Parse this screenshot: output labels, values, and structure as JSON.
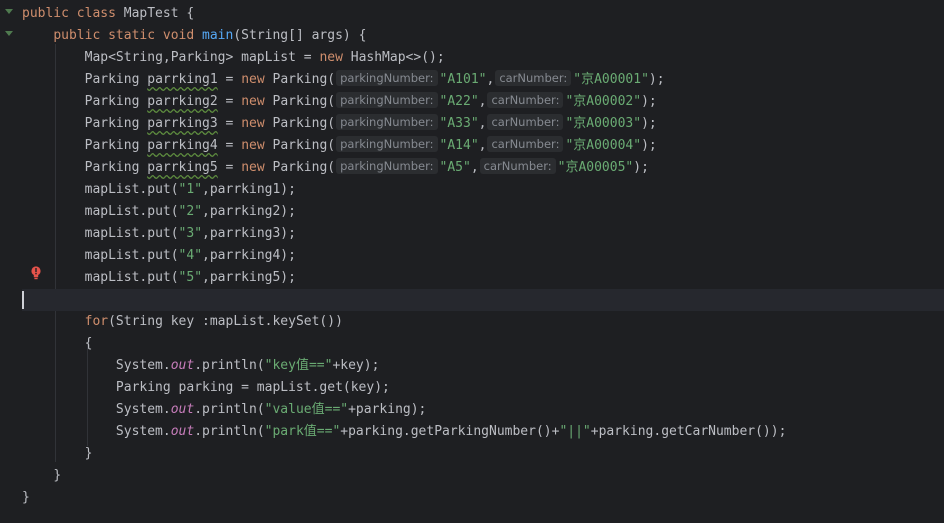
{
  "editor": {
    "lines": [
      {
        "indent": "",
        "tokens": [
          {
            "t": "public class ",
            "c": "kw"
          },
          {
            "t": "MapTest {",
            "c": "plain"
          }
        ]
      },
      {
        "indent": "    ",
        "tokens": [
          {
            "t": "public static void ",
            "c": "kw"
          },
          {
            "t": "main",
            "c": "fn"
          },
          {
            "t": "(String[] args) {",
            "c": "plain"
          }
        ]
      },
      {
        "indent": "        ",
        "tokens": [
          {
            "t": "Map<String,Parking> mapList = ",
            "c": "plain"
          },
          {
            "t": "new ",
            "c": "kw"
          },
          {
            "t": "HashMap<>();",
            "c": "plain"
          }
        ]
      },
      {
        "indent": "        ",
        "tokens": [
          {
            "t": "Parking ",
            "c": "plain"
          },
          {
            "t": "parrking1",
            "c": "plain warn"
          },
          {
            "t": " = ",
            "c": "plain"
          },
          {
            "t": "new ",
            "c": "kw"
          },
          {
            "t": "Parking(",
            "c": "plain"
          },
          {
            "t": "parkingNumber:",
            "c": "hint"
          },
          {
            "t": "\"A101\"",
            "c": "str"
          },
          {
            "t": ",",
            "c": "plain"
          },
          {
            "t": "carNumber:",
            "c": "hint"
          },
          {
            "t": "\"京A00001\"",
            "c": "str"
          },
          {
            "t": ");",
            "c": "plain"
          }
        ]
      },
      {
        "indent": "        ",
        "tokens": [
          {
            "t": "Parking ",
            "c": "plain"
          },
          {
            "t": "parrking2",
            "c": "plain warn"
          },
          {
            "t": " = ",
            "c": "plain"
          },
          {
            "t": "new ",
            "c": "kw"
          },
          {
            "t": "Parking(",
            "c": "plain"
          },
          {
            "t": "parkingNumber:",
            "c": "hint"
          },
          {
            "t": "\"A22\"",
            "c": "str"
          },
          {
            "t": ",",
            "c": "plain"
          },
          {
            "t": "carNumber:",
            "c": "hint"
          },
          {
            "t": "\"京A00002\"",
            "c": "str"
          },
          {
            "t": ");",
            "c": "plain"
          }
        ]
      },
      {
        "indent": "        ",
        "tokens": [
          {
            "t": "Parking ",
            "c": "plain"
          },
          {
            "t": "parrking3",
            "c": "plain warn"
          },
          {
            "t": " = ",
            "c": "plain"
          },
          {
            "t": "new ",
            "c": "kw"
          },
          {
            "t": "Parking(",
            "c": "plain"
          },
          {
            "t": "parkingNumber:",
            "c": "hint"
          },
          {
            "t": "\"A33\"",
            "c": "str"
          },
          {
            "t": ",",
            "c": "plain"
          },
          {
            "t": "carNumber:",
            "c": "hint"
          },
          {
            "t": "\"京A00003\"",
            "c": "str"
          },
          {
            "t": ");",
            "c": "plain"
          }
        ]
      },
      {
        "indent": "        ",
        "tokens": [
          {
            "t": "Parking ",
            "c": "plain"
          },
          {
            "t": "parrking4",
            "c": "plain warn"
          },
          {
            "t": " = ",
            "c": "plain"
          },
          {
            "t": "new ",
            "c": "kw"
          },
          {
            "t": "Parking(",
            "c": "plain"
          },
          {
            "t": "parkingNumber:",
            "c": "hint"
          },
          {
            "t": "\"A14\"",
            "c": "str"
          },
          {
            "t": ",",
            "c": "plain"
          },
          {
            "t": "carNumber:",
            "c": "hint"
          },
          {
            "t": "\"京A00004\"",
            "c": "str"
          },
          {
            "t": ");",
            "c": "plain"
          }
        ]
      },
      {
        "indent": "        ",
        "tokens": [
          {
            "t": "Parking ",
            "c": "plain"
          },
          {
            "t": "parrking5",
            "c": "plain warn"
          },
          {
            "t": " = ",
            "c": "plain"
          },
          {
            "t": "new ",
            "c": "kw"
          },
          {
            "t": "Parking(",
            "c": "plain"
          },
          {
            "t": "parkingNumber:",
            "c": "hint"
          },
          {
            "t": "\"A5\"",
            "c": "str"
          },
          {
            "t": ",",
            "c": "plain"
          },
          {
            "t": "carNumber:",
            "c": "hint"
          },
          {
            "t": "\"京A00005\"",
            "c": "str"
          },
          {
            "t": ");",
            "c": "plain"
          }
        ]
      },
      {
        "indent": "        ",
        "tokens": [
          {
            "t": "mapList.put(",
            "c": "plain"
          },
          {
            "t": "\"1\"",
            "c": "str"
          },
          {
            "t": ",parrking1);",
            "c": "plain"
          }
        ]
      },
      {
        "indent": "        ",
        "tokens": [
          {
            "t": "mapList.put(",
            "c": "plain"
          },
          {
            "t": "\"2\"",
            "c": "str"
          },
          {
            "t": ",parrking2);",
            "c": "plain"
          }
        ]
      },
      {
        "indent": "        ",
        "tokens": [
          {
            "t": "mapList.put(",
            "c": "plain"
          },
          {
            "t": "\"3\"",
            "c": "str"
          },
          {
            "t": ",parrking3);",
            "c": "plain"
          }
        ]
      },
      {
        "indent": "        ",
        "tokens": [
          {
            "t": "mapList.put(",
            "c": "plain"
          },
          {
            "t": "\"4\"",
            "c": "str"
          },
          {
            "t": ",parrking4);",
            "c": "plain"
          }
        ]
      },
      {
        "indent": "        ",
        "tokens": [
          {
            "t": "mapList.put(",
            "c": "plain"
          },
          {
            "t": "\"5\"",
            "c": "str"
          },
          {
            "t": ",parrking5);",
            "c": "plain"
          }
        ]
      },
      {
        "indent": "",
        "tokens": [],
        "current": true
      },
      {
        "indent": "        ",
        "tokens": [
          {
            "t": "for",
            "c": "kw"
          },
          {
            "t": "(String key :mapList.keySet())",
            "c": "plain"
          }
        ]
      },
      {
        "indent": "        ",
        "tokens": [
          {
            "t": "{",
            "c": "plain"
          }
        ]
      },
      {
        "indent": "            ",
        "tokens": [
          {
            "t": "System.",
            "c": "plain"
          },
          {
            "t": "out",
            "c": "static-field"
          },
          {
            "t": ".println(",
            "c": "plain"
          },
          {
            "t": "\"key值==\"",
            "c": "str"
          },
          {
            "t": "+key);",
            "c": "plain"
          }
        ]
      },
      {
        "indent": "            ",
        "tokens": [
          {
            "t": "Parking parking = mapList.get(key);",
            "c": "plain"
          }
        ]
      },
      {
        "indent": "            ",
        "tokens": [
          {
            "t": "System.",
            "c": "plain"
          },
          {
            "t": "out",
            "c": "static-field"
          },
          {
            "t": ".println(",
            "c": "plain"
          },
          {
            "t": "\"value值==\"",
            "c": "str"
          },
          {
            "t": "+parking);",
            "c": "plain"
          }
        ]
      },
      {
        "indent": "            ",
        "tokens": [
          {
            "t": "System.",
            "c": "plain"
          },
          {
            "t": "out",
            "c": "static-field"
          },
          {
            "t": ".println(",
            "c": "plain"
          },
          {
            "t": "\"park值==\"",
            "c": "str"
          },
          {
            "t": "+parking.getParkingNumber()+",
            "c": "plain"
          },
          {
            "t": "\"||\"",
            "c": "str"
          },
          {
            "t": "+parking.getCarNumber());",
            "c": "plain"
          }
        ]
      },
      {
        "indent": "        ",
        "tokens": [
          {
            "t": "}",
            "c": "plain"
          }
        ]
      },
      {
        "indent": "    ",
        "tokens": [
          {
            "t": "}",
            "c": "plain"
          }
        ]
      },
      {
        "indent": "",
        "tokens": [
          {
            "t": "}",
            "c": "plain"
          }
        ]
      }
    ]
  },
  "icons": {
    "fold": "fold-arrow-icon",
    "intention": "lightbulb-error-icon"
  },
  "colors": {
    "background": "#1e1f22",
    "keyword": "#cf8e6d",
    "method": "#56a8f5",
    "string": "#6aab73",
    "static_field": "#c77dbb",
    "text": "#bcbec4",
    "hint_bg": "#2b2d30",
    "hint_fg": "#868a91",
    "bulb": "#e5534b"
  }
}
